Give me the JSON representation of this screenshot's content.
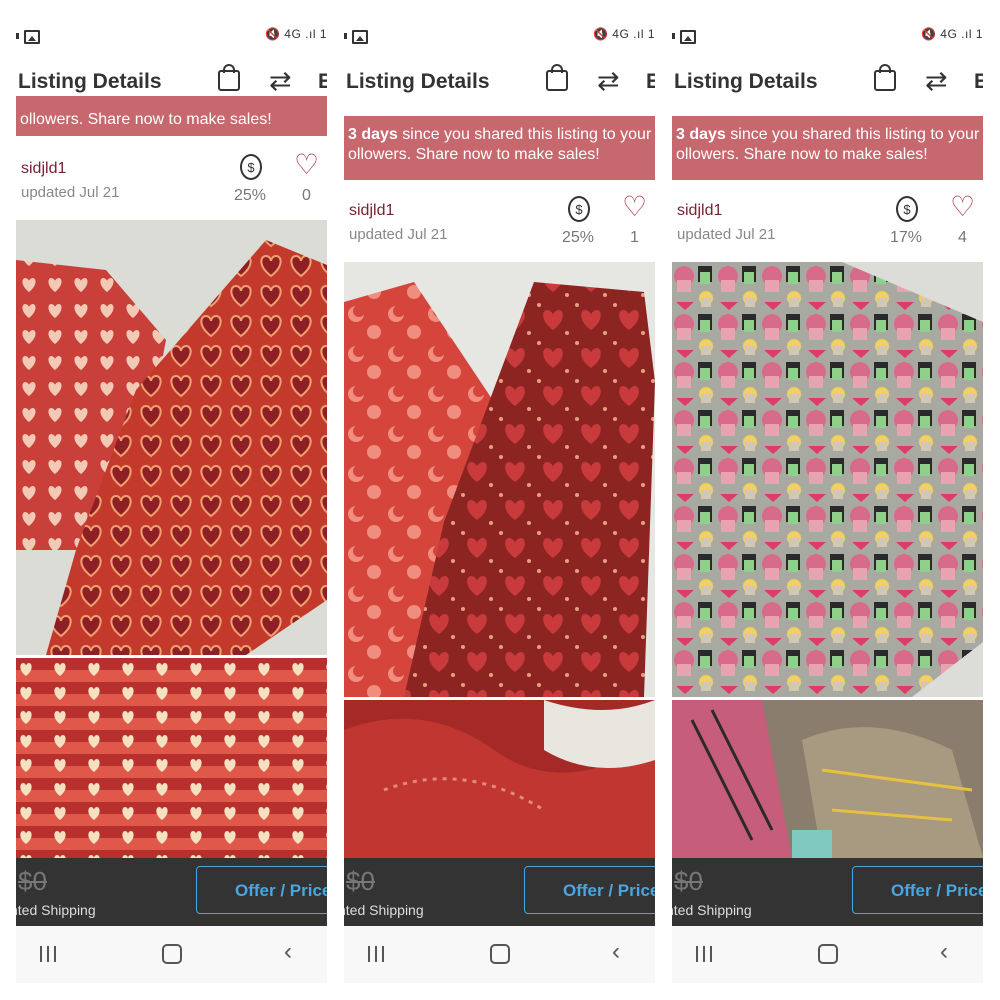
{
  "panels": [
    {
      "status": {
        "icons": "🔇 4G .ıl 1"
      },
      "header": {
        "title": "Listing Details",
        "more_label": "E"
      },
      "banner": {
        "days_text": "",
        "rest_line1": "",
        "line2": "ollowers. Share now to make sales!"
      },
      "seller": {
        "username": "sidjld1",
        "updated": "updated Jul 21",
        "price_drop": "25%",
        "likes": "0"
      },
      "bottom": {
        "price": "$0",
        "shipping": "nted Shipping",
        "offer_label": "Offer / Price D"
      }
    },
    {
      "status": {
        "icons": "🔇 4G .ıl 1"
      },
      "header": {
        "title": "Listing Details",
        "more_label": "E"
      },
      "banner": {
        "days_text": "3 days",
        "rest_line1": " since you shared this listing to your",
        "line2": "ollowers. Share now to make sales!"
      },
      "seller": {
        "username": "sidjld1",
        "updated": "updated Jul 21",
        "price_drop": "25%",
        "likes": "1"
      },
      "bottom": {
        "price": "$0",
        "shipping": "nted Shipping",
        "offer_label": "Offer / Price D"
      }
    },
    {
      "status": {
        "icons": "🔇 4G .ıl 1"
      },
      "header": {
        "title": "Listing Details",
        "more_label": "E"
      },
      "banner": {
        "days_text": "3 days",
        "rest_line1": " since you shared this listing to your",
        "line2": "ollowers. Share now to make sales!"
      },
      "seller": {
        "username": "sidjld1",
        "updated": "updated Jul 21",
        "price_drop": "17%",
        "likes": "4"
      },
      "bottom": {
        "price": "$0",
        "shipping": "nted Shipping",
        "offer_label": "Offer / Price D"
      }
    }
  ],
  "icons": {
    "gallery": "gallery-icon",
    "bag": "shopping-bag-icon",
    "share": "share-icon",
    "price_drop": "price-drop-icon",
    "heart": "heart-icon",
    "nav": [
      "recent-apps-icon",
      "home-icon",
      "back-icon"
    ]
  },
  "colors": {
    "banner": "#c6686d",
    "username": "#7a2232",
    "offer": "#4aa6e0",
    "bottom_bar": "#333333"
  }
}
